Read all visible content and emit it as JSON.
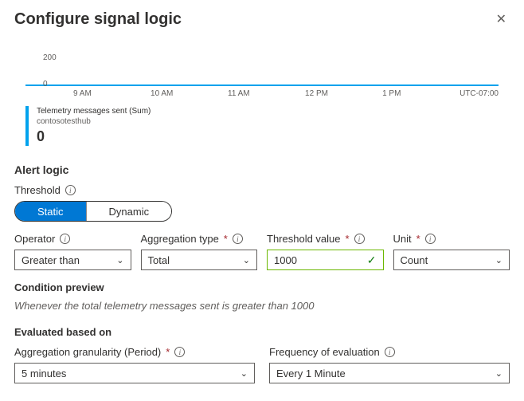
{
  "header": {
    "title": "Configure signal logic"
  },
  "chart_data": {
    "type": "line",
    "x": [
      "9 AM",
      "10 AM",
      "11 AM",
      "12 PM",
      "1 PM"
    ],
    "series": [
      {
        "name": "Telemetry messages sent (Sum)",
        "values": [
          0,
          0,
          0,
          0,
          0
        ]
      }
    ],
    "ylim": [
      0,
      200
    ],
    "yticks": [
      0,
      200
    ],
    "tz": "UTC-07:00",
    "legend": {
      "metric": "Telemetry messages sent (Sum)",
      "resource": "contosotesthub",
      "value": "0"
    }
  },
  "alert": {
    "section": "Alert logic",
    "threshold_label": "Threshold",
    "seg": {
      "static": "Static",
      "dynamic": "Dynamic"
    },
    "operator": {
      "label": "Operator",
      "value": "Greater than"
    },
    "aggregation": {
      "label": "Aggregation type",
      "value": "Total"
    },
    "threshold_value": {
      "label": "Threshold value",
      "value": "1000"
    },
    "unit": {
      "label": "Unit",
      "value": "Count"
    },
    "condition_preview_label": "Condition preview",
    "condition_preview": "Whenever the total telemetry messages sent is greater than 1000"
  },
  "eval": {
    "section": "Evaluated based on",
    "granularity": {
      "label": "Aggregation granularity (Period)",
      "value": "5 minutes"
    },
    "frequency": {
      "label": "Frequency of evaluation",
      "value": "Every 1 Minute"
    }
  }
}
